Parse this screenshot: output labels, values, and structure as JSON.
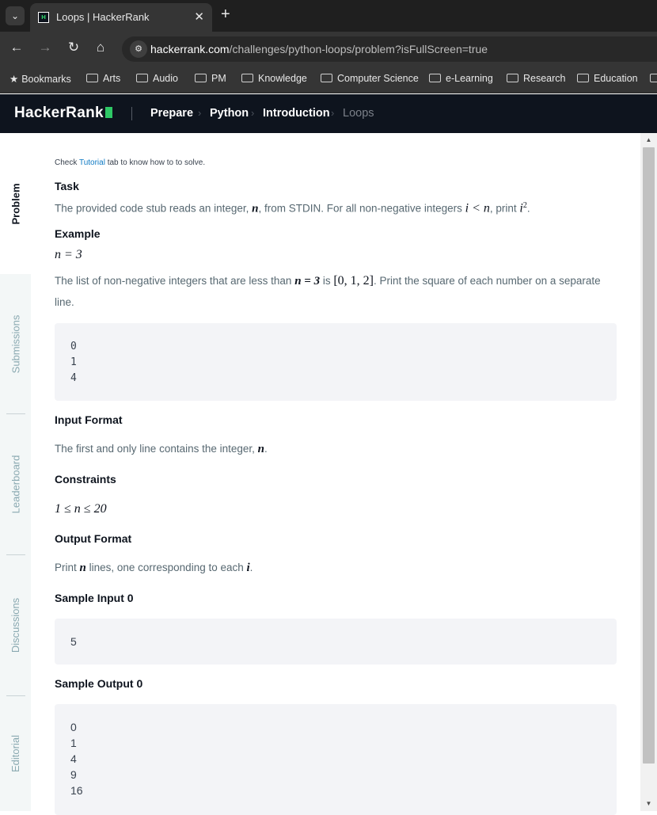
{
  "browser": {
    "tab_title": "Loops | HackerRank",
    "tab_favicon_text": "H",
    "new_tab_label": "+",
    "close_tab_label": "✕",
    "url_host": "hackerrank.com",
    "url_path": "/challenges/python-loops/problem?isFullScreen=true",
    "bookmarks_label": "Bookmarks",
    "bookmark_folders": [
      "Arts",
      "Audio",
      "PM",
      "Knowledge",
      "Computer Science",
      "e-Learning",
      "Research",
      "Education"
    ]
  },
  "header": {
    "logo": "HackerRank",
    "breadcrumbs": [
      "Prepare",
      "Python",
      "Introduction",
      "Loops"
    ]
  },
  "side_tabs": [
    "Problem",
    "Submissions",
    "Leaderboard",
    "Discussions",
    "Editorial"
  ],
  "problem": {
    "hint_pre": "Check ",
    "hint_link": "Tutorial",
    "hint_post": " tab to know how to to solve.",
    "task_heading": "Task",
    "task_text_1": "The provided code stub reads an integer, ",
    "task_var_n": "n",
    "task_text_2": ", from STDIN. For all non-negative integers ",
    "task_ineq": "i < n",
    "task_text_3": ", print ",
    "task_expr_base": "i",
    "task_expr_exp": "2",
    "task_text_4": ".",
    "example_heading": "Example",
    "example_eq": "n = 3",
    "example_line1_pre": "The list of non-negative integers that are less than ",
    "example_line1_eq": "n = 3",
    "example_line1_mid": " is ",
    "example_line1_list": "[0, 1, 2]",
    "example_line1_post": ". Print the square of each number on a separate",
    "example_line2": "line.",
    "example_output": [
      "0",
      "1",
      "4"
    ],
    "input_heading": "Input Format",
    "input_text_pre": "The first and only line contains the integer, ",
    "input_text_var": "n",
    "input_text_post": ".",
    "constraints_heading": "Constraints",
    "constraints_expr": "1 ≤ n ≤ 20",
    "output_heading": "Output Format",
    "output_text_pre": "Print ",
    "output_text_var": "n",
    "output_text_mid": " lines, one corresponding to each ",
    "output_text_var2": "i",
    "output_text_post": ".",
    "sample_input_heading": "Sample Input 0",
    "sample_input": [
      "5"
    ],
    "sample_output_heading": "Sample Output 0",
    "sample_output": [
      "0",
      "1",
      "4",
      "9",
      "16"
    ]
  },
  "colors": {
    "header_bg": "#0e141e",
    "brand_green": "#2ec866",
    "link_blue": "#0e7ac4"
  }
}
